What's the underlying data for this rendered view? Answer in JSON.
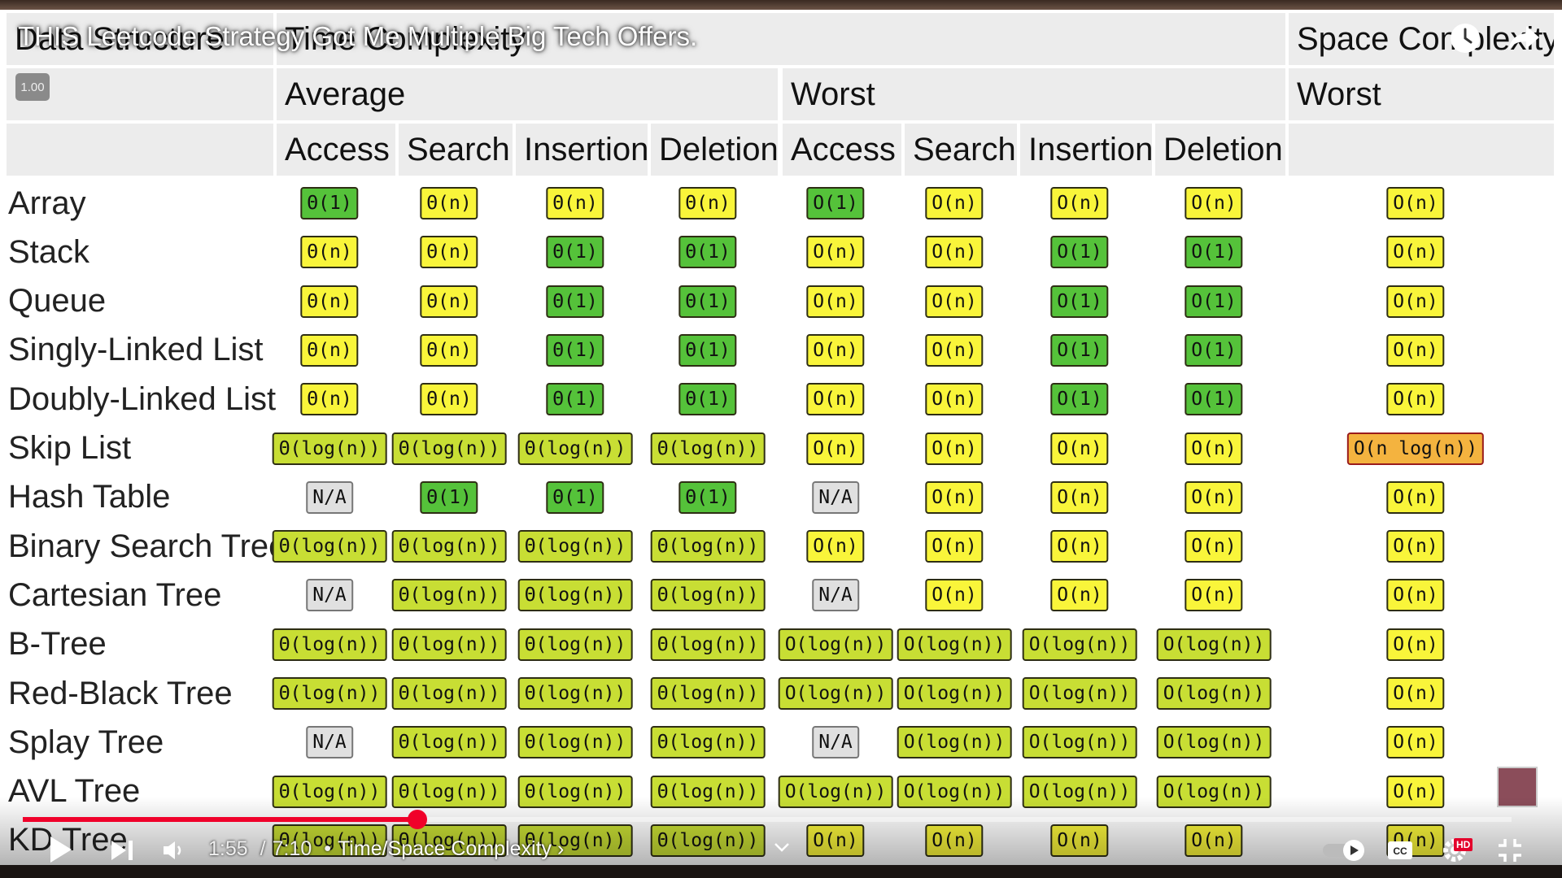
{
  "video": {
    "title": "THIS Leetcode Strategy Got Me Multiple Big Tech Offers.",
    "speed_badge": "1.00",
    "current_time": "1:55",
    "duration": "7:10",
    "time_separator": "/",
    "chapter_separator": "•",
    "chapter": "Time/Space Complexity",
    "chapter_arrow": "›",
    "progress": 0.265,
    "progress_color": "#f0002a",
    "hd_badge": "HD"
  },
  "table": {
    "headers": {
      "data_structure": "Data Structure",
      "time_complexity": "Time Complexity",
      "space_complexity": "Space Complexity",
      "average": "Average",
      "worst": "Worst",
      "space_worst": "Worst",
      "ops": [
        "Access",
        "Search",
        "Insertion",
        "Deletion",
        "Access",
        "Search",
        "Insertion",
        "Deletion"
      ]
    },
    "colors": {
      "excellent": "#55c23a",
      "good": "#c8de34",
      "fair": "#f9f53a",
      "bad": "#f4b33f",
      "na": "#e0e0e0",
      "header_bg": "#ececec"
    },
    "rows": [
      {
        "name": "Array",
        "cells": [
          [
            "Θ(1)",
            "excellent"
          ],
          [
            "Θ(n)",
            "fair"
          ],
          [
            "Θ(n)",
            "fair"
          ],
          [
            "Θ(n)",
            "fair"
          ],
          [
            "O(1)",
            "excellent"
          ],
          [
            "O(n)",
            "fair"
          ],
          [
            "O(n)",
            "fair"
          ],
          [
            "O(n)",
            "fair"
          ],
          [
            "O(n)",
            "fair"
          ]
        ]
      },
      {
        "name": "Stack",
        "cells": [
          [
            "Θ(n)",
            "fair"
          ],
          [
            "Θ(n)",
            "fair"
          ],
          [
            "Θ(1)",
            "excellent"
          ],
          [
            "Θ(1)",
            "excellent"
          ],
          [
            "O(n)",
            "fair"
          ],
          [
            "O(n)",
            "fair"
          ],
          [
            "O(1)",
            "excellent"
          ],
          [
            "O(1)",
            "excellent"
          ],
          [
            "O(n)",
            "fair"
          ]
        ]
      },
      {
        "name": "Queue",
        "cells": [
          [
            "Θ(n)",
            "fair"
          ],
          [
            "Θ(n)",
            "fair"
          ],
          [
            "Θ(1)",
            "excellent"
          ],
          [
            "Θ(1)",
            "excellent"
          ],
          [
            "O(n)",
            "fair"
          ],
          [
            "O(n)",
            "fair"
          ],
          [
            "O(1)",
            "excellent"
          ],
          [
            "O(1)",
            "excellent"
          ],
          [
            "O(n)",
            "fair"
          ]
        ]
      },
      {
        "name": "Singly-Linked List",
        "cells": [
          [
            "Θ(n)",
            "fair"
          ],
          [
            "Θ(n)",
            "fair"
          ],
          [
            "Θ(1)",
            "excellent"
          ],
          [
            "Θ(1)",
            "excellent"
          ],
          [
            "O(n)",
            "fair"
          ],
          [
            "O(n)",
            "fair"
          ],
          [
            "O(1)",
            "excellent"
          ],
          [
            "O(1)",
            "excellent"
          ],
          [
            "O(n)",
            "fair"
          ]
        ]
      },
      {
        "name": "Doubly-Linked List",
        "cells": [
          [
            "Θ(n)",
            "fair"
          ],
          [
            "Θ(n)",
            "fair"
          ],
          [
            "Θ(1)",
            "excellent"
          ],
          [
            "Θ(1)",
            "excellent"
          ],
          [
            "O(n)",
            "fair"
          ],
          [
            "O(n)",
            "fair"
          ],
          [
            "O(1)",
            "excellent"
          ],
          [
            "O(1)",
            "excellent"
          ],
          [
            "O(n)",
            "fair"
          ]
        ]
      },
      {
        "name": "Skip List",
        "cells": [
          [
            "Θ(log(n))",
            "good"
          ],
          [
            "Θ(log(n))",
            "good"
          ],
          [
            "Θ(log(n))",
            "good"
          ],
          [
            "Θ(log(n))",
            "good"
          ],
          [
            "O(n)",
            "fair"
          ],
          [
            "O(n)",
            "fair"
          ],
          [
            "O(n)",
            "fair"
          ],
          [
            "O(n)",
            "fair"
          ],
          [
            "O(n log(n))",
            "bad"
          ]
        ]
      },
      {
        "name": "Hash Table",
        "cells": [
          [
            "N/A",
            "na"
          ],
          [
            "Θ(1)",
            "excellent"
          ],
          [
            "Θ(1)",
            "excellent"
          ],
          [
            "Θ(1)",
            "excellent"
          ],
          [
            "N/A",
            "na"
          ],
          [
            "O(n)",
            "fair"
          ],
          [
            "O(n)",
            "fair"
          ],
          [
            "O(n)",
            "fair"
          ],
          [
            "O(n)",
            "fair"
          ]
        ]
      },
      {
        "name": "Binary Search Tree",
        "cells": [
          [
            "Θ(log(n))",
            "good"
          ],
          [
            "Θ(log(n))",
            "good"
          ],
          [
            "Θ(log(n))",
            "good"
          ],
          [
            "Θ(log(n))",
            "good"
          ],
          [
            "O(n)",
            "fair"
          ],
          [
            "O(n)",
            "fair"
          ],
          [
            "O(n)",
            "fair"
          ],
          [
            "O(n)",
            "fair"
          ],
          [
            "O(n)",
            "fair"
          ]
        ]
      },
      {
        "name": "Cartesian Tree",
        "cells": [
          [
            "N/A",
            "na"
          ],
          [
            "Θ(log(n))",
            "good"
          ],
          [
            "Θ(log(n))",
            "good"
          ],
          [
            "Θ(log(n))",
            "good"
          ],
          [
            "N/A",
            "na"
          ],
          [
            "O(n)",
            "fair"
          ],
          [
            "O(n)",
            "fair"
          ],
          [
            "O(n)",
            "fair"
          ],
          [
            "O(n)",
            "fair"
          ]
        ]
      },
      {
        "name": "B-Tree",
        "cells": [
          [
            "Θ(log(n))",
            "good"
          ],
          [
            "Θ(log(n))",
            "good"
          ],
          [
            "Θ(log(n))",
            "good"
          ],
          [
            "Θ(log(n))",
            "good"
          ],
          [
            "O(log(n))",
            "good"
          ],
          [
            "O(log(n))",
            "good"
          ],
          [
            "O(log(n))",
            "good"
          ],
          [
            "O(log(n))",
            "good"
          ],
          [
            "O(n)",
            "fair"
          ]
        ]
      },
      {
        "name": "Red-Black Tree",
        "cells": [
          [
            "Θ(log(n))",
            "good"
          ],
          [
            "Θ(log(n))",
            "good"
          ],
          [
            "Θ(log(n))",
            "good"
          ],
          [
            "Θ(log(n))",
            "good"
          ],
          [
            "O(log(n))",
            "good"
          ],
          [
            "O(log(n))",
            "good"
          ],
          [
            "O(log(n))",
            "good"
          ],
          [
            "O(log(n))",
            "good"
          ],
          [
            "O(n)",
            "fair"
          ]
        ]
      },
      {
        "name": "Splay Tree",
        "cells": [
          [
            "N/A",
            "na"
          ],
          [
            "Θ(log(n))",
            "good"
          ],
          [
            "Θ(log(n))",
            "good"
          ],
          [
            "Θ(log(n))",
            "good"
          ],
          [
            "N/A",
            "na"
          ],
          [
            "O(log(n))",
            "good"
          ],
          [
            "O(log(n))",
            "good"
          ],
          [
            "O(log(n))",
            "good"
          ],
          [
            "O(n)",
            "fair"
          ]
        ]
      },
      {
        "name": "AVL Tree",
        "cells": [
          [
            "Θ(log(n))",
            "good"
          ],
          [
            "Θ(log(n))",
            "good"
          ],
          [
            "Θ(log(n))",
            "good"
          ],
          [
            "Θ(log(n))",
            "good"
          ],
          [
            "O(log(n))",
            "good"
          ],
          [
            "O(log(n))",
            "good"
          ],
          [
            "O(log(n))",
            "good"
          ],
          [
            "O(log(n))",
            "good"
          ],
          [
            "O(n)",
            "fair"
          ]
        ]
      },
      {
        "name": "KD Tree",
        "cells": [
          [
            "Θ(log(n))",
            "good"
          ],
          [
            "Θ(log(n))",
            "good"
          ],
          [
            "Θ(log(n))",
            "good"
          ],
          [
            "Θ(log(n))",
            "good"
          ],
          [
            "O(n)",
            "fair"
          ],
          [
            "O(n)",
            "fair"
          ],
          [
            "O(n)",
            "fair"
          ],
          [
            "O(n)",
            "fair"
          ],
          [
            "O(n)",
            "fair"
          ]
        ]
      }
    ]
  }
}
